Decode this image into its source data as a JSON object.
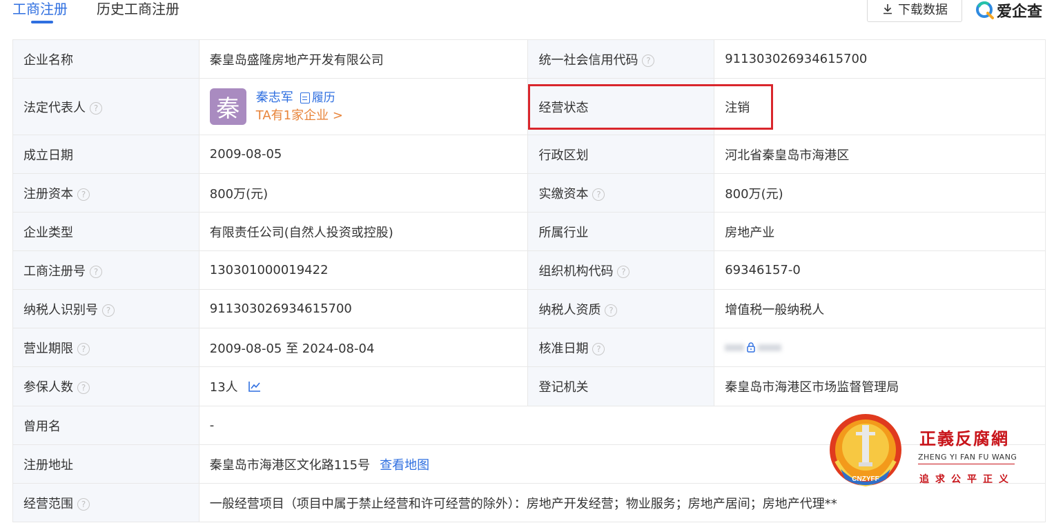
{
  "header": {
    "tabs": [
      {
        "label": "工商注册",
        "active": true
      },
      {
        "label": "历史工商注册",
        "active": false
      }
    ],
    "download_label": "下载数据",
    "brand": "爱企查"
  },
  "table": {
    "row1": {
      "label1": "企业名称",
      "value1": "秦皇岛盛隆房地产开发有限公司",
      "label2": "统一社会信用代码",
      "value2": "911303026934615700"
    },
    "row2": {
      "label1": "法定代表人",
      "rep_avatar": "秦",
      "rep_name": "秦志军",
      "rep_resume": "履历",
      "rep_companies": "TA有1家企业 >",
      "label2": "经营状态",
      "value2": "注销"
    },
    "row3": {
      "label1": "成立日期",
      "value1": "2009-08-05",
      "label2": "行政区划",
      "value2": "河北省秦皇岛市海港区"
    },
    "row4": {
      "label1": "注册资本",
      "value1": "800万(元)",
      "label2": "实缴资本",
      "value2": "800万(元)"
    },
    "row5": {
      "label1": "企业类型",
      "value1": "有限责任公司(自然人投资或控股)",
      "label2": "所属行业",
      "value2": "房地产业"
    },
    "row6": {
      "label1": "工商注册号",
      "value1": "130301000019422",
      "label2": "组织机构代码",
      "value2": "69346157-0"
    },
    "row7": {
      "label1": "纳税人识别号",
      "value1": "911303026934615700",
      "label2": "纳税人资质",
      "value2": "增值税一般纳税人"
    },
    "row8": {
      "label1": "营业期限",
      "value1": "2009-08-05 至 2024-08-04",
      "label2": "核准日期"
    },
    "row9": {
      "label1": "参保人数",
      "value1": "13人",
      "label2": "登记机关",
      "value2": "秦皇岛市海港区市场监督管理局"
    },
    "row10": {
      "label1": "曾用名",
      "value1": "-"
    },
    "row11": {
      "label1": "注册地址",
      "value1": "秦皇岛市海港区文化路115号",
      "map_link": "查看地图"
    },
    "row12": {
      "label1": "经营范围",
      "value1": "一般经营项目（项目中属于禁止经营和许可经营的除外）：房地产开发经营；物业服务；房地产居间；房地产代理**"
    }
  },
  "watermark": {
    "title": "正義反腐網",
    "pinyin": "ZHENG YI FAN FU WANG",
    "slogan": "追求公平正义",
    "seal_text": "CNZYFF"
  },
  "colors": {
    "accent": "#2f6fe0",
    "highlight_box": "#d9262c",
    "rep_company_link": "#e8843a",
    "avatar_bg": "#a98bc0",
    "label_bg": "#f5f7fb"
  }
}
